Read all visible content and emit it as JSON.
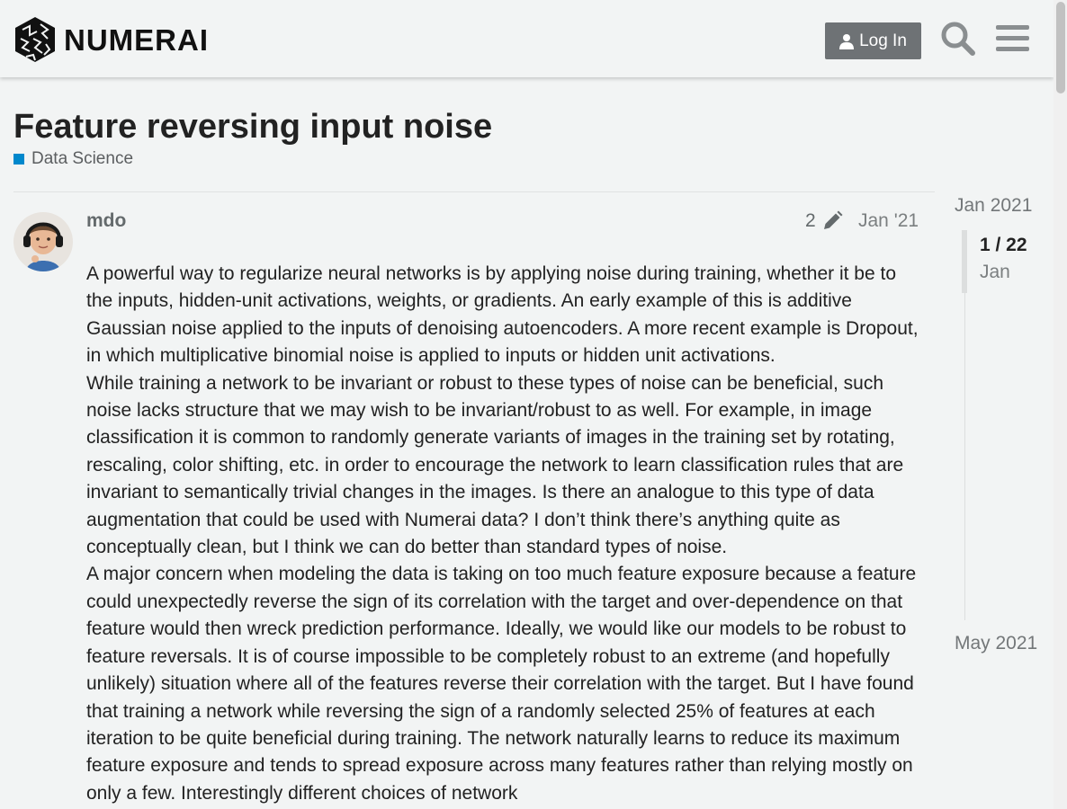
{
  "header": {
    "logo_text": "NUMERAI",
    "login_label": "Log In"
  },
  "topic": {
    "title": "Feature reversing input noise",
    "category": "Data Science",
    "category_color": "#0088cc"
  },
  "post": {
    "username": "mdo",
    "edit_count": "2",
    "date": "Jan '21",
    "paragraphs": [
      "A powerful way to regularize neural networks is by applying noise during training, whether it be to the inputs, hidden-unit activations, weights, or gradients. An early example of this is additive Gaussian noise applied to the inputs of denoising autoencoders. A more recent example is Dropout, in which multiplicative binomial noise is applied to inputs or hidden unit activations.",
      "While training a network to be invariant or robust to these types of noise can be beneficial, such noise lacks structure that we may wish to be invariant/robust to as well. For example, in image classification it is common to randomly generate variants of images in the training set by rotating, rescaling, color shifting, etc. in order to encourage the network to learn classification rules that are invariant to semantically trivial changes in the images. Is there an analogue to this type of data augmentation that could be used with Numerai data? I don’t think there’s anything quite as conceptually clean, but I think we can do better than standard types of noise.",
      "A major concern when modeling the data is taking on too much feature exposure because a feature could unexpectedly reverse the sign of its correlation with the target and over-dependence on that feature would then wreck prediction performance. Ideally, we would like our models to be robust to feature reversals. It is of course impossible to be completely robust to an extreme (and hopefully unlikely) situation where all of the features reverse their correlation with the target. But I have found that training a network while reversing the sign of a randomly selected 25% of features at each iteration to be quite beneficial during training. The network naturally learns to reduce its maximum feature exposure and tends to spread exposure across many features rather than relying mostly on only a few. Interestingly different choices of network"
    ]
  },
  "timeline": {
    "start": "Jan 2021",
    "position": "1 / 22",
    "current_month": "Jan",
    "end": "May 2021"
  }
}
